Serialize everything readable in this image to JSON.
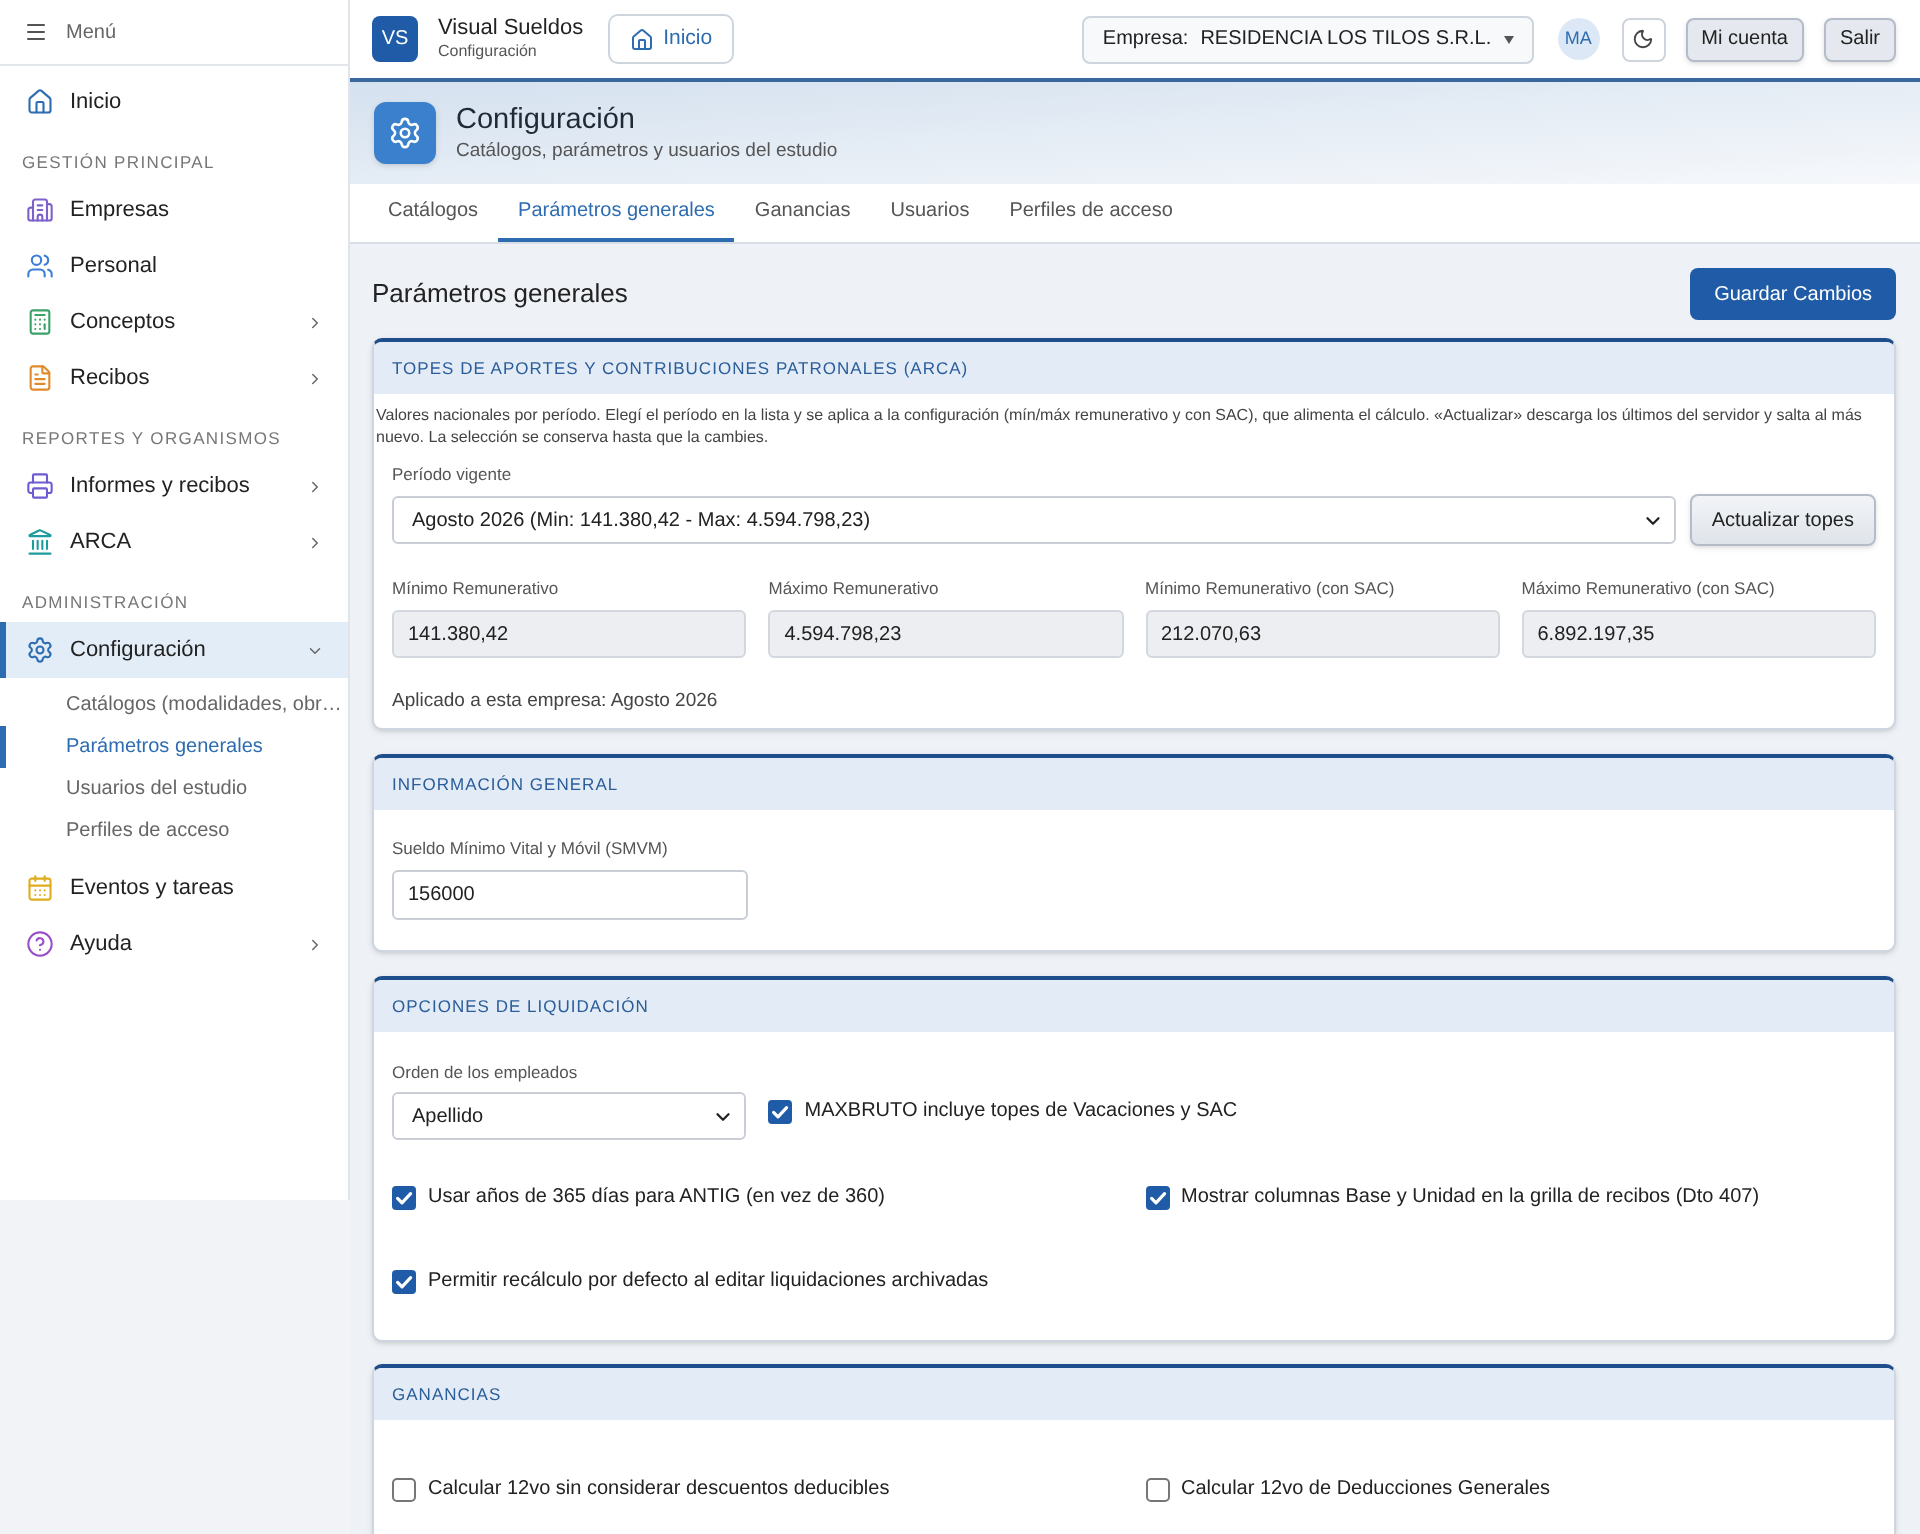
{
  "sidebar": {
    "header": "Menú",
    "sections": [
      {
        "items": [
          {
            "label": "Inicio",
            "kind": "link",
            "selected": false
          }
        ]
      },
      {
        "title": "GESTIÓN PRINCIPAL",
        "items": [
          {
            "label": "Empresas",
            "kind": "link",
            "selected": false
          },
          {
            "label": "Personal",
            "kind": "link",
            "selected": false
          },
          {
            "label": "Conceptos",
            "kind": "group",
            "expanded": false,
            "selected": false
          },
          {
            "label": "Recibos",
            "kind": "group",
            "expanded": false,
            "selected": false
          }
        ]
      },
      {
        "title": "REPORTES Y ORGANISMOS",
        "items": [
          {
            "label": "Informes y recibos",
            "kind": "group",
            "expanded": false,
            "selected": false
          },
          {
            "label": "ARCA",
            "kind": "group",
            "expanded": false,
            "selected": false
          }
        ]
      },
      {
        "title": "ADMINISTRACIÓN",
        "items": [
          {
            "label": "Configuración",
            "kind": "group",
            "expanded": true,
            "selected": true,
            "children": [
              {
                "label": "Catálogos (modalidades, obr…",
                "selected": false
              },
              {
                "label": "Parámetros generales",
                "selected": true
              },
              {
                "label": "Usuarios del estudio",
                "selected": false
              },
              {
                "label": "Perfiles de acceso",
                "selected": false
              }
            ]
          },
          {
            "label": "Eventos y tareas",
            "kind": "link",
            "selected": false
          },
          {
            "label": "Ayuda",
            "kind": "group",
            "expanded": false,
            "selected": false
          }
        ]
      }
    ]
  },
  "header": {
    "logo": "VS",
    "title": "Visual Sueldos",
    "subtitle": "Configuración",
    "home_button": "Inicio",
    "company_select": {
      "label": "Empresa:",
      "value": "RESIDENCIA LOS TILOS S.R.L."
    },
    "avatar": "MA",
    "buttons": [
      "Mi cuenta",
      "Salir"
    ]
  },
  "banner": {
    "title": "Configuración",
    "subtitle": "Catálogos, parámetros y usuarios del estudio"
  },
  "tabs": [
    {
      "label": "Catálogos",
      "selected": false
    },
    {
      "label": "Parámetros generales",
      "selected": true
    },
    {
      "label": "Ganancias",
      "selected": false
    },
    {
      "label": "Usuarios",
      "selected": false
    },
    {
      "label": "Perfiles de acceso",
      "selected": false
    }
  ],
  "page": {
    "title": "Parámetros generales",
    "save_button": "Guardar Cambios"
  },
  "topes": {
    "title": "TOPES DE APORTES Y CONTRIBUCIONES PATRONALES (ARCA)",
    "description": "Valores nacionales por período. Elegí el período en la lista y se aplica a la configuración (mín/máx remunerativo y con SAC), que alimenta el cálculo. «Actualizar» descarga los últimos del servidor y salta al más nuevo. La selección se conserva hasta que la cambies.",
    "period": {
      "label": "Período vigente",
      "value": "Agosto 2026 (Min: 141.380,42 - Max: 4.594.798,23)"
    },
    "refresh_button": "Actualizar topes",
    "fields": [
      {
        "label": "Mínimo Remunerativo",
        "value": "141.380,42"
      },
      {
        "label": "Máximo Remunerativo",
        "value": "4.594.798,23"
      },
      {
        "label": "Mínimo Remunerativo (con SAC)",
        "value": "212.070,63"
      },
      {
        "label": "Máximo Remunerativo (con SAC)",
        "value": "6.892.197,35"
      }
    ],
    "applied": "Aplicado a esta empresa: Agosto 2026"
  },
  "informacion_general": {
    "title": "INFORMACIÓN GENERAL",
    "field": {
      "label": "Sueldo Mínimo Vital y Móvil (SMVM)",
      "value": "156000"
    }
  },
  "opciones_liquidacion": {
    "title": "OPCIONES DE LIQUIDACIÓN",
    "order": {
      "label": "Orden de los empleados",
      "value": "Apellido"
    },
    "checkboxes": [
      {
        "label": "MAXBRUTO incluye topes de Vacaciones y SAC",
        "checked": true
      },
      {
        "label": "Usar años de 365 días para ANTIG (en vez de 360)",
        "checked": true
      },
      {
        "label": "Mostrar columnas Base y Unidad en la grilla de recibos (Dto 407)",
        "checked": true
      },
      {
        "label": "Permitir recálculo por defecto al editar liquidaciones archivadas",
        "checked": true
      }
    ]
  },
  "ganancias": {
    "title": "GANANCIAS",
    "checkboxes": [
      {
        "label": "Calcular 12vo sin considerar descuentos deducibles",
        "checked": false
      },
      {
        "label": "Calcular 12vo de Deducciones Generales",
        "checked": false
      }
    ]
  }
}
